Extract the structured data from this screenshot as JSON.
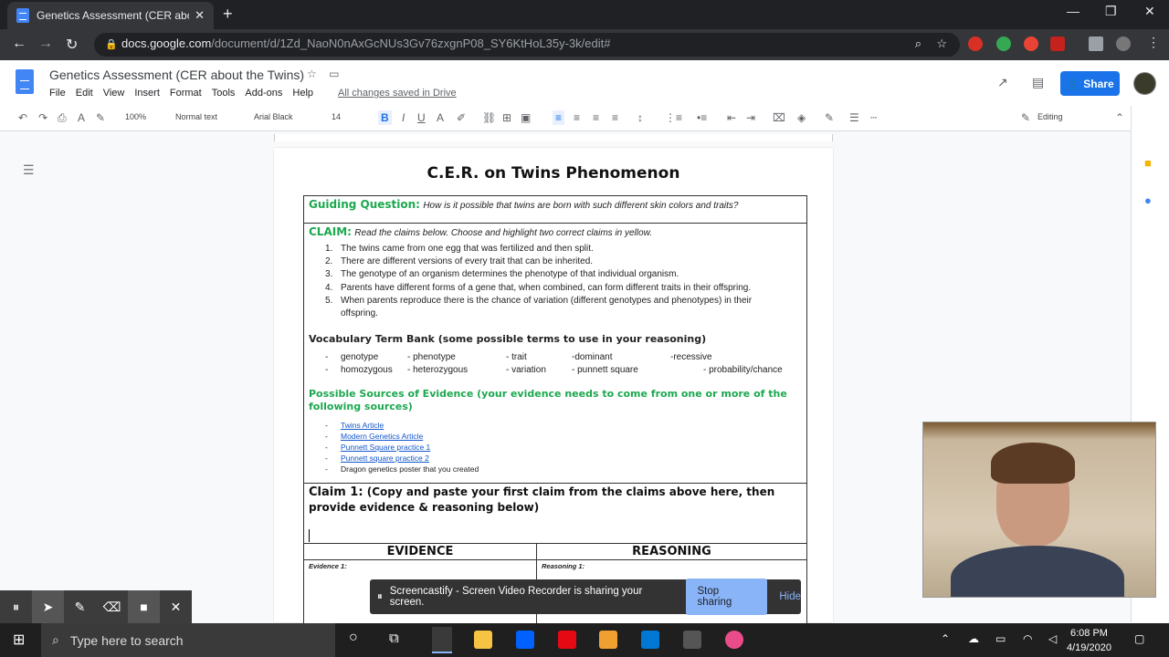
{
  "browser": {
    "tab_title": "Genetics Assessment (CER about",
    "url_host": "docs.google.com",
    "url_path": "/document/d/1Zd_NaoN0nAxGcNUs3Gv76zxgnP08_SY6KtHoL35y-3k/edit#"
  },
  "docs": {
    "title": "Genetics Assessment (CER about the Twins)",
    "menu": [
      "File",
      "Edit",
      "View",
      "Insert",
      "Format",
      "Tools",
      "Add-ons",
      "Help"
    ],
    "saved_status": "All changes saved in Drive",
    "share_label": "Share"
  },
  "toolbar": {
    "zoom": "100%",
    "style": "Normal text",
    "font": "Arial Black",
    "size": "14",
    "mode": "Editing"
  },
  "document": {
    "heading": "C.E.R. on Twins Phenomenon",
    "guiding_label": "Guiding Question:",
    "guiding_text": "How is it possible that twins are born with such different skin colors and traits?",
    "claim_label": "CLAIM:",
    "claim_text": "Read the claims below. Choose and highlight two correct claims in yellow.",
    "claims": [
      "The twins came from one egg that was fertilized and then split.",
      "There are different versions of every trait that can be inherited.",
      "The genotype of an organism determines the phenotype of that individual organism.",
      "Parents have different forms of a gene that, when combined, can form different traits in their offspring.",
      "When parents reproduce there is the chance of variation (different genotypes and phenotypes)  in their"
    ],
    "claim5_cont": "offspring.",
    "vocab_heading": "Vocabulary Term Bank (some possible terms to use in your reasoning)",
    "vocab_row1": [
      "genotype",
      "- phenotype",
      "- trait",
      "-dominant",
      "-recessive"
    ],
    "vocab_row2": [
      "homozygous",
      "- heterozygous",
      "- variation",
      "- punnett square",
      "- probability/chance"
    ],
    "sources_heading": "Possible Sources of Evidence (your evidence needs to come from one or more of the following sources)",
    "sources": [
      "Twins Article",
      "Modern Genetics Article",
      "Punnett Square practice 1",
      "Punnett square practice 2"
    ],
    "sources_plain": "Dragon genetics poster that you created",
    "claim1_label": "Claim 1:",
    "claim1_text": "(Copy and paste your first claim from the claims above here, then provide evidence & reasoning below)",
    "evidence_header": "EVIDENCE",
    "reasoning_header": "REASONING",
    "evidence_1": "Evidence 1:",
    "reasoning_1": "Reasoning 1:"
  },
  "screencastify": {
    "message": "Screencastify - Screen Video Recorder is sharing your screen.",
    "stop_label": "Stop sharing",
    "hide_label": "Hide"
  },
  "taskbar": {
    "search_placeholder": "Type here to search",
    "time": "6:08 PM",
    "date": "4/19/2020"
  }
}
